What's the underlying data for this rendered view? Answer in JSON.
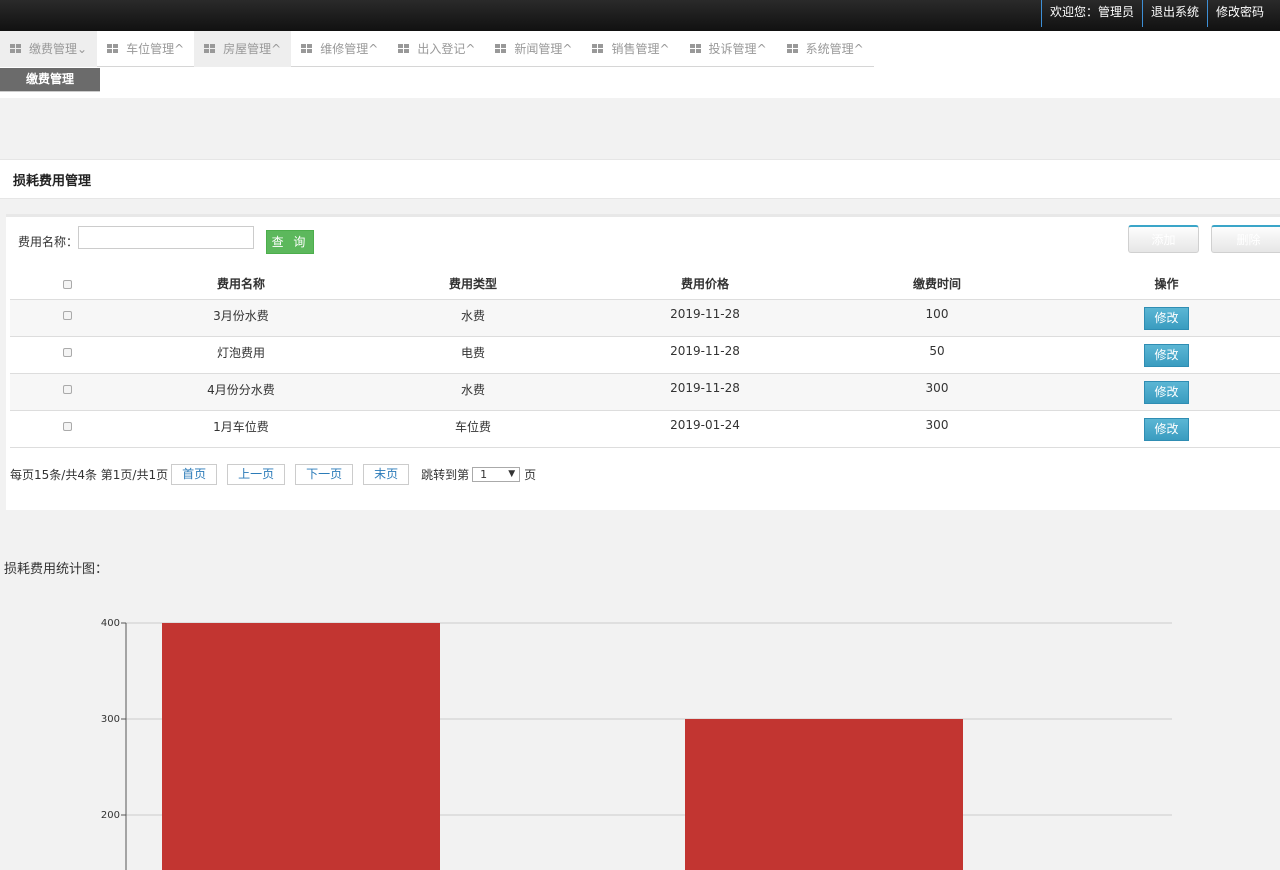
{
  "topbar": {
    "welcome": "欢迎您：管理员",
    "logout": "退出系统",
    "change_password": "修改密码"
  },
  "nav": {
    "items": [
      {
        "label": "缴费管理",
        "arrow": "⌄"
      },
      {
        "label": "车位管理",
        "arrow": "^"
      },
      {
        "label": "房屋管理",
        "arrow": "^"
      },
      {
        "label": "维修管理",
        "arrow": "^"
      },
      {
        "label": "出入登记",
        "arrow": "^"
      },
      {
        "label": "新闻管理",
        "arrow": "^"
      },
      {
        "label": "销售管理",
        "arrow": "^"
      },
      {
        "label": "投诉管理",
        "arrow": "^"
      },
      {
        "label": "系统管理",
        "arrow": "^"
      }
    ],
    "submenu_label": "缴费管理"
  },
  "page_title": "损耗费用管理",
  "search": {
    "label": "费用名称：",
    "value": "",
    "query_button": "查 询",
    "add_button": "添加",
    "delete_button": "删除"
  },
  "table": {
    "headers": [
      "费用名称",
      "费用类型",
      "费用价格",
      "缴费时间",
      "操作"
    ],
    "rows": [
      {
        "name": "3月份水费",
        "type": "水费",
        "col3": "2019-11-28",
        "col4": "100",
        "action": "修改"
      },
      {
        "name": "灯泡费用",
        "type": "电费",
        "col3": "2019-11-28",
        "col4": "50",
        "action": "修改"
      },
      {
        "name": "4月份分水费",
        "type": "水费",
        "col3": "2019-11-28",
        "col4": "300",
        "action": "修改"
      },
      {
        "name": "1月车位费",
        "type": "车位费",
        "col3": "2019-01-24",
        "col4": "300",
        "action": "修改"
      }
    ]
  },
  "pager": {
    "summary": "每页15条/共4条 第1页/共1页",
    "first": "首页",
    "prev": "上一页",
    "next": "下一页",
    "last": "末页",
    "jump_label": "跳转到第",
    "page_value": "1",
    "page_unit": "页"
  },
  "chart_title": "损耗费用统计图：",
  "colors": {
    "bar": "#c23531",
    "accent": "#3a9cc0",
    "query_green": "#5cb85c"
  },
  "chart_data": {
    "type": "bar",
    "categories": [
      "",
      ""
    ],
    "values": [
      400,
      300
    ],
    "visible_ylim": [
      150,
      400
    ],
    "yticks": [
      200,
      300,
      400
    ],
    "grid": true
  }
}
